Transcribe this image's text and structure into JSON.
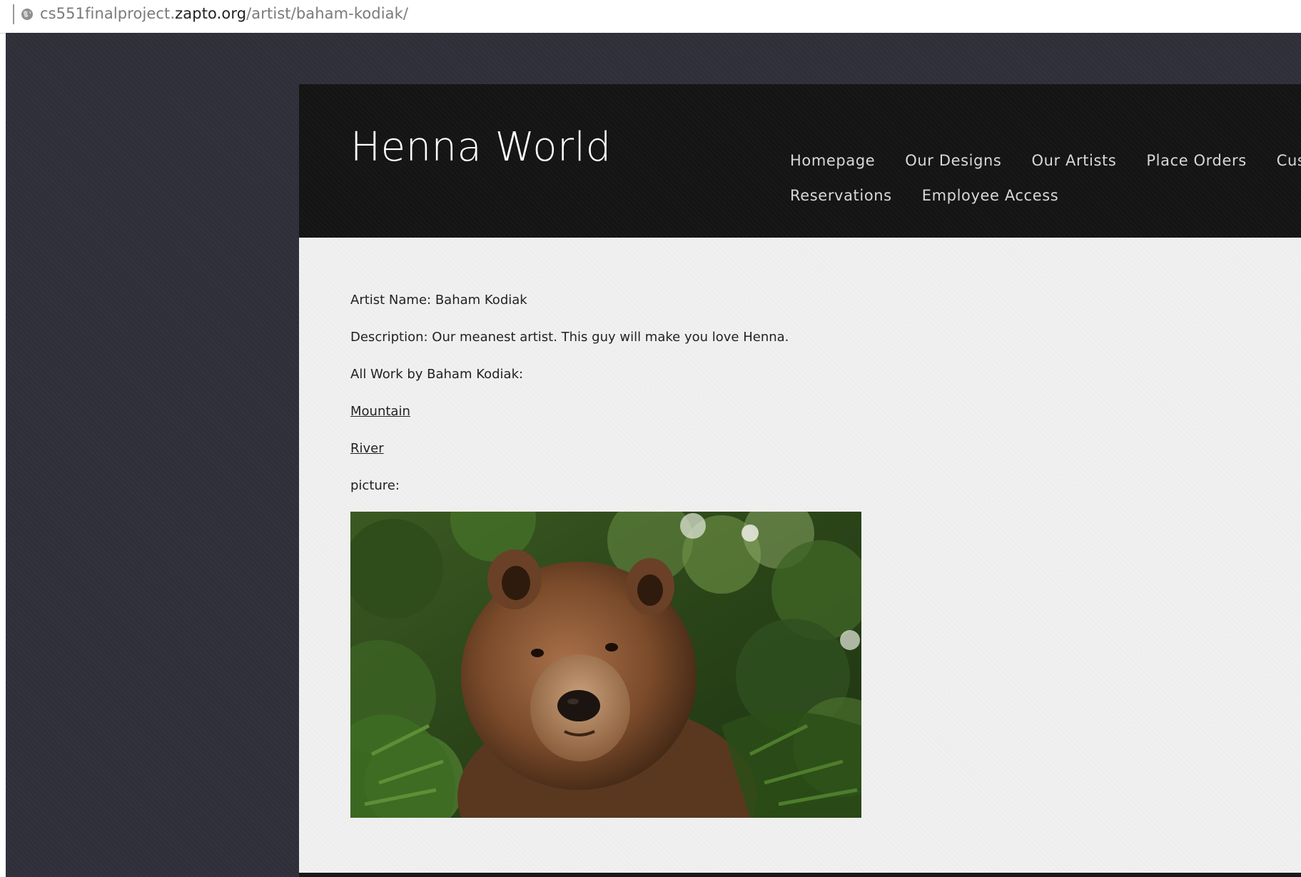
{
  "browser": {
    "url_prefix": "cs551finalproject.",
    "url_host": "zapto.org",
    "url_path": "/artist/baham-kodiak/"
  },
  "site": {
    "title": "Henna World",
    "nav_row1": [
      "Homepage",
      "Our Designs",
      "Our Artists",
      "Place Orders",
      "Custo"
    ],
    "nav_row2": [
      "Reservations",
      "Employee Access"
    ]
  },
  "artist": {
    "name_line": "Artist Name: Baham Kodiak",
    "description_line": "Description: Our meanest artist. This guy will make you love Henna.",
    "works_heading": "All Work by Baham Kodiak:",
    "works": [
      "Mountain",
      "River"
    ],
    "picture_label": "picture:"
  },
  "icons": {
    "address_icon": "globe-icon"
  },
  "colors": {
    "page_bg": "#2e2f38",
    "header_bg": "#141414",
    "content_bg": "#f0f0f0"
  }
}
